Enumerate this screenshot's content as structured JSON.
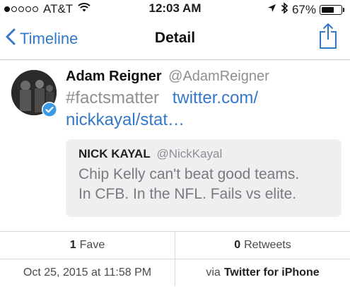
{
  "status_bar": {
    "signal_bars_total": 5,
    "signal_bars_filled": 1,
    "carrier": "AT&T",
    "time": "12:03 AM",
    "battery_percent": "67%",
    "battery_level": 0.67
  },
  "nav": {
    "back_label": "Timeline",
    "title": "Detail"
  },
  "tweet": {
    "author_name": "Adam Reigner",
    "author_handle": "@AdamReigner",
    "hashtag": "#factsmatter",
    "link_line1": "twitter.com/",
    "link_line2": "nickkayal/stat…",
    "quoted": {
      "name": "NICK KAYAL",
      "handle": "@NickKayal",
      "text_line1": "Chip Kelly can't beat good teams.",
      "text_line2": "In CFB. In the NFL. Fails vs elite."
    }
  },
  "stats": {
    "faves_count": "1",
    "faves_label": "Fave",
    "retweets_count": "0",
    "retweets_label": "Retweets",
    "date": "Oct 25, 2015 at 11:58 PM",
    "via_prefix": "via",
    "client": "Twitter for iPhone"
  },
  "colors": {
    "accent": "#3478c9",
    "muted": "#8e8e93",
    "quote_background": "#efeff1"
  },
  "icons": {
    "back": "chevron-left-icon",
    "share": "share-icon",
    "verified": "verified-badge-icon",
    "wifi": "wifi-icon",
    "location": "location-arrow-icon",
    "bluetooth": "bluetooth-icon"
  }
}
